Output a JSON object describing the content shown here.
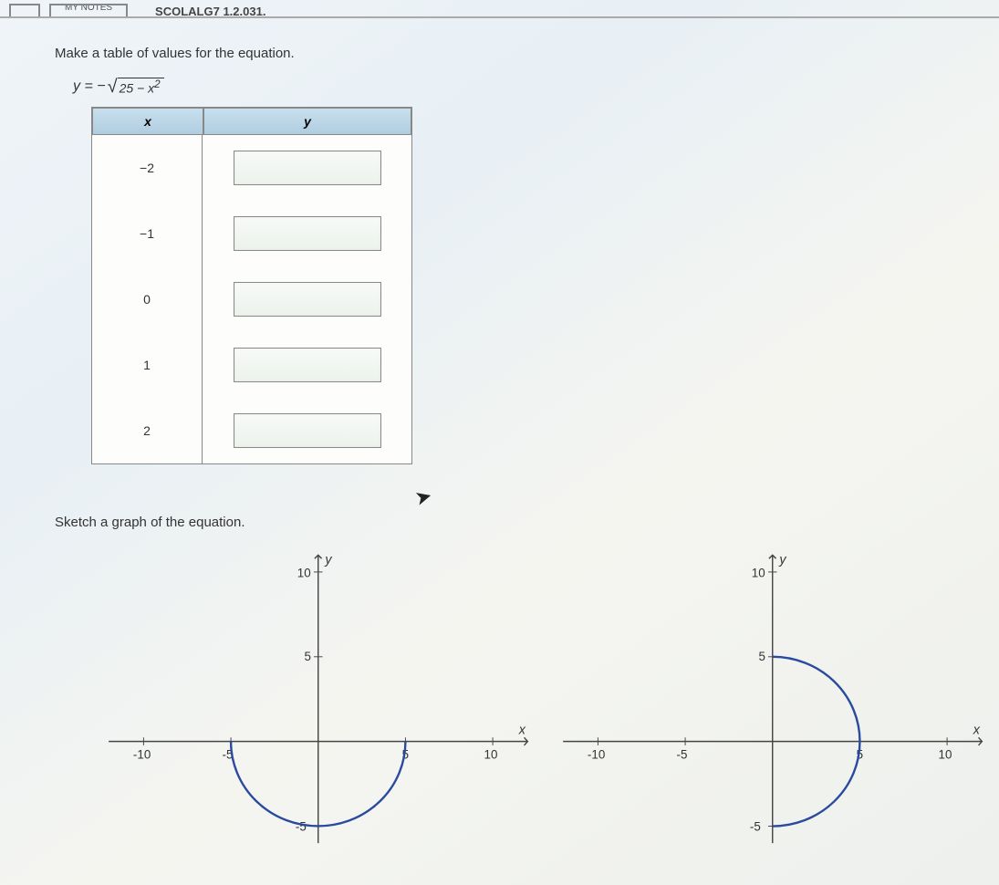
{
  "topbar": {
    "chips": [
      "",
      "MY NOTES"
    ],
    "breadcrumb": "SCOLALG7 1.2.031."
  },
  "prompt1": "Make a table of values for the equation.",
  "equation": {
    "lhs": "y = −",
    "radicand_a": "25 − x",
    "radicand_exp": "2"
  },
  "table": {
    "headers": {
      "x": "x",
      "y": "y"
    },
    "rows": [
      {
        "x": "−2",
        "y": ""
      },
      {
        "x": "−1",
        "y": ""
      },
      {
        "x": "0",
        "y": ""
      },
      {
        "x": "1",
        "y": ""
      },
      {
        "x": "2",
        "y": ""
      }
    ]
  },
  "prompt2": "Sketch a graph of the equation.",
  "chart_data": [
    {
      "type": "line",
      "title": "",
      "xlabel": "x",
      "ylabel": "y",
      "xlim": [
        -12,
        12
      ],
      "ylim": [
        -6,
        11
      ],
      "xticks": [
        -10,
        -5,
        5,
        10
      ],
      "yticks": [
        -5,
        5,
        10
      ],
      "series": [
        {
          "name": "lower-semicircle",
          "equation": "y = -sqrt(25 - x^2)",
          "xrange": [
            -5,
            5
          ],
          "radius": 5,
          "center": [
            0,
            0
          ]
        }
      ]
    },
    {
      "type": "line",
      "title": "",
      "xlabel": "x",
      "ylabel": "y",
      "xlim": [
        -12,
        12
      ],
      "ylim": [
        -6,
        11
      ],
      "xticks": [
        -10,
        -5,
        5,
        10
      ],
      "yticks": [
        -5,
        5,
        10
      ],
      "series": [
        {
          "name": "right-semicircle",
          "equation": "x = sqrt(25 - y^2)",
          "yrange": [
            -5,
            5
          ],
          "radius": 5,
          "center": [
            0,
            0
          ]
        }
      ]
    }
  ]
}
